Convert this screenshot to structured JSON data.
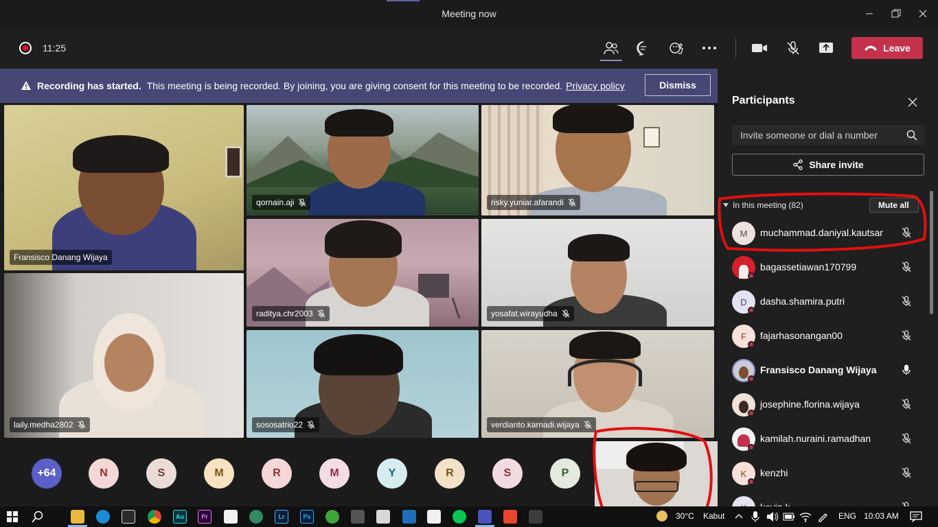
{
  "window": {
    "title": "Meeting now"
  },
  "toolbar": {
    "timer": "11:25",
    "leave_label": "Leave"
  },
  "banner": {
    "bold": "Recording has started.",
    "text": "This meeting is being recorded. By joining, you are giving consent for this meeting to be recorded.",
    "link": "Privacy policy",
    "dismiss": "Dismiss"
  },
  "tiles": [
    {
      "name": "Fransisco Danang Wijaya",
      "muted": false
    },
    {
      "name": "qornain.aji",
      "muted": true
    },
    {
      "name": "risky.yuniar.afarandi",
      "muted": true
    },
    {
      "name": "raditya.chr2003",
      "muted": true
    },
    {
      "name": "yosafat.wirayudha",
      "muted": true
    },
    {
      "name": "laily.medha2802",
      "muted": true
    },
    {
      "name": "sososatrio22",
      "muted": true
    },
    {
      "name": "verdianto.karnadi.wijaya",
      "muted": true
    }
  ],
  "overflow": {
    "more_count": "+64",
    "avatars": [
      "N",
      "S",
      "M",
      "R",
      "M",
      "Y",
      "R",
      "S",
      "P"
    ]
  },
  "panel": {
    "title": "Participants",
    "invite_placeholder": "Invite someone or dial a number",
    "share_label": "Share invite",
    "section_label": "In this meeting (82)",
    "mute_all": "Mute all",
    "participants": [
      {
        "name": "muchammad.daniyal.kautsar",
        "initial": "M",
        "muted": true
      },
      {
        "name": "bagassetiawan170799",
        "initial": "",
        "muted": true
      },
      {
        "name": "dasha.shamira.putri",
        "initial": "D",
        "muted": true
      },
      {
        "name": "fajarhasonangan00",
        "initial": "F",
        "muted": true
      },
      {
        "name": "Fransisco Danang Wijaya",
        "initial": "",
        "muted": false
      },
      {
        "name": "josephine.florina.wijaya",
        "initial": "",
        "muted": true
      },
      {
        "name": "kamilah.nuraini.ramadhan",
        "initial": "",
        "muted": true
      },
      {
        "name": "kenzhi",
        "initial": "K",
        "muted": true
      },
      {
        "name": "kevin.k",
        "initial": "K",
        "muted": true
      }
    ]
  },
  "taskbar": {
    "weather": "30°C",
    "weather_text": "Kabut",
    "language": "ENG",
    "clock": "10:03 AM",
    "apps": [
      "Au",
      "Pr",
      "Lr",
      "Ps"
    ]
  }
}
